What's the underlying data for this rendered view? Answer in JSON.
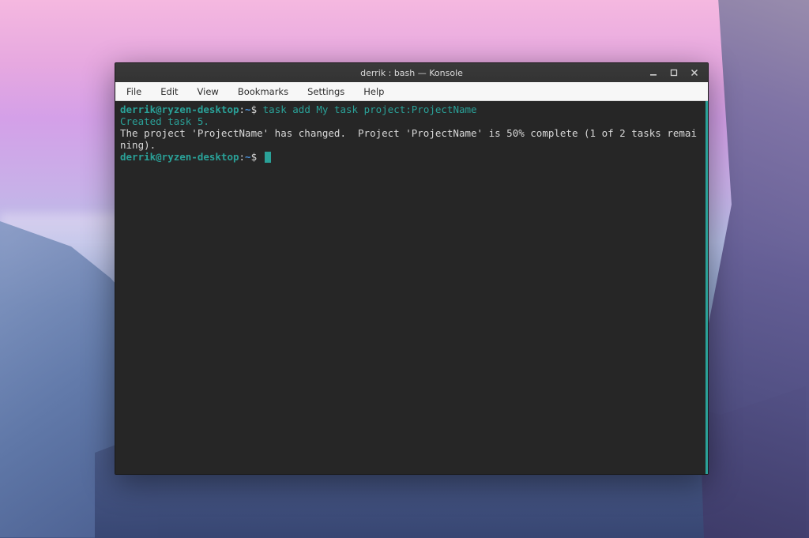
{
  "window": {
    "title": "derrik : bash — Konsole"
  },
  "menubar": {
    "items": [
      "File",
      "Edit",
      "View",
      "Bookmarks",
      "Settings",
      "Help"
    ]
  },
  "terminal": {
    "lines": [
      {
        "prompt": {
          "user_host": "derrik@ryzen-desktop",
          "colon": ":",
          "path": "~",
          "dollar": "$ "
        },
        "command": "task add My task project:ProjectName"
      },
      {
        "created": "Created task 5."
      },
      {
        "output": "The project 'ProjectName' has changed.  Project 'ProjectName' is 50% complete (1 of 2 tasks remaining)."
      },
      {
        "prompt": {
          "user_host": "derrik@ryzen-desktop",
          "colon": ":",
          "path": "~",
          "dollar": "$ "
        },
        "cursor": true
      }
    ]
  },
  "colors": {
    "terminal_bg": "#262626",
    "accent": "#2aa198",
    "path": "#4a8fd6",
    "fg": "#d8d8d8"
  }
}
